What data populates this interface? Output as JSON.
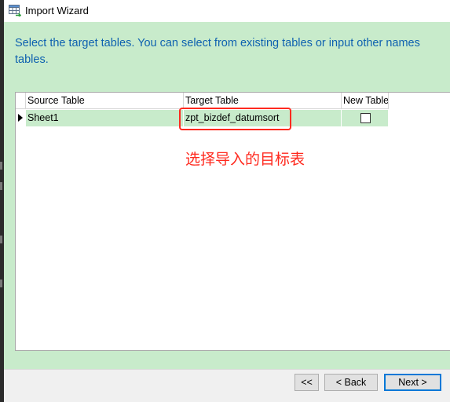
{
  "window": {
    "title": "Import Wizard",
    "icon": "table-import-icon"
  },
  "instruction": "Select the target tables. You can select from existing tables or input other names tables.",
  "grid": {
    "columns": [
      "Source Table",
      "Target Table",
      "New Table"
    ],
    "rows": [
      {
        "source_table": "Sheet1",
        "target_table": "zpt_bizdef_datumsort",
        "new_table": false
      }
    ]
  },
  "annotation": {
    "text": "选择导入的目标表",
    "color": "#ff2a1f"
  },
  "footer": {
    "first_label": "<<",
    "back_label": "< Back",
    "next_label": "Next >"
  },
  "colors": {
    "content_background": "#c8ebcb",
    "instruction_text": "#0e61b0",
    "highlight": "#ff2a1f",
    "primary_button_border": "#0078d7"
  }
}
